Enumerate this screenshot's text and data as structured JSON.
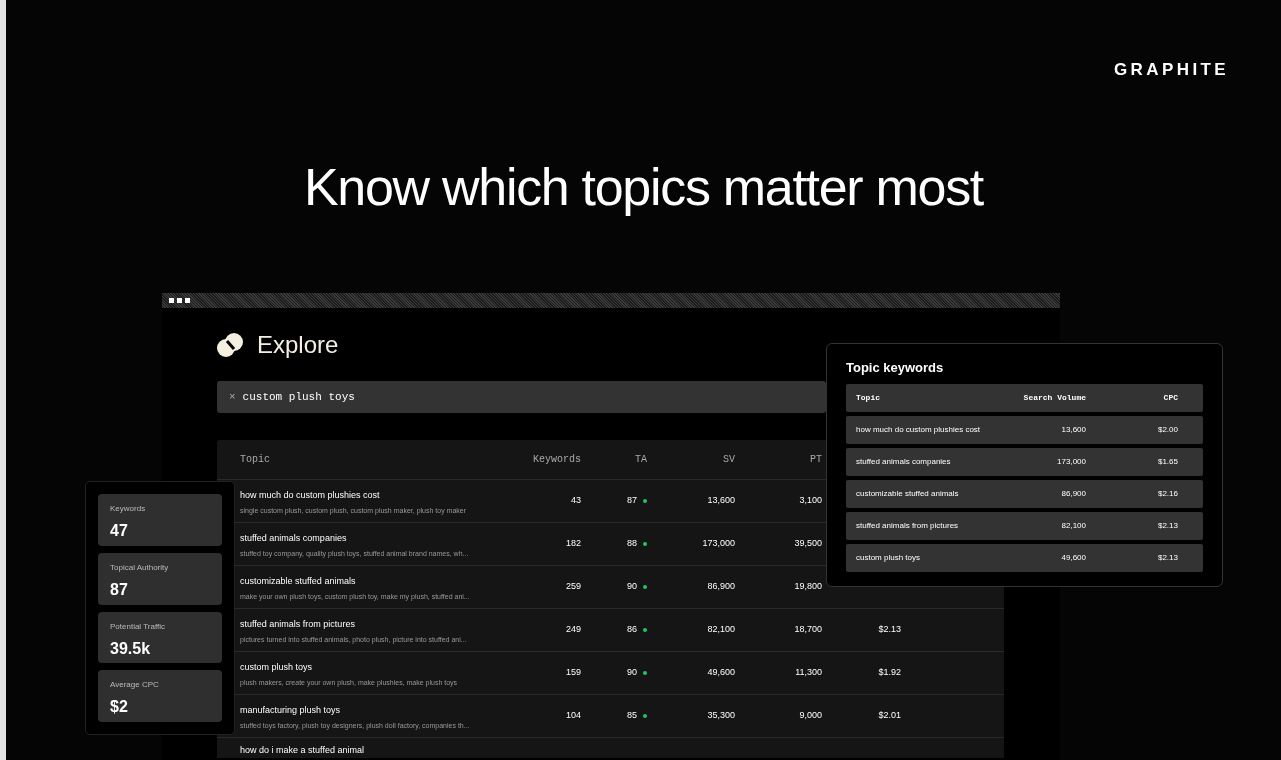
{
  "brand": "GRAPHITE",
  "headline": "Know which topics matter most",
  "app": {
    "title": "Explore",
    "search": {
      "clear": "×",
      "value": "custom plush toys"
    },
    "table": {
      "columns": [
        "Topic",
        "Keywords",
        "TA",
        "SV",
        "PT"
      ],
      "rows": [
        {
          "topic": "how much do custom plushies cost",
          "keywords_list": "single custom plush, custom plush, custom plush maker, plush toy maker",
          "keywords": "43",
          "ta": "87",
          "color": "#22c55e",
          "sv": "13,600",
          "pt": "3,100"
        },
        {
          "topic": "stuffed animals companies",
          "keywords_list": "stuffed toy company, quality plush toys, stuffed animal brand names, wh...",
          "keywords": "182",
          "ta": "88",
          "color": "#22c55e",
          "sv": "173,000",
          "pt": "39,500"
        },
        {
          "topic": "customizable stuffed animals",
          "keywords_list": "make your own plush toys, custom plush toy, make my plush, stuffed ani...",
          "keywords": "259",
          "ta": "90",
          "color": "#22c55e",
          "sv": "86,900",
          "pt": "19,800"
        },
        {
          "topic": "stuffed animals from pictures",
          "keywords_list": "pictures turned into stuffed animals, photo plush, picture into stuffed ani...",
          "keywords": "249",
          "ta": "86",
          "color": "#22c55e",
          "sv": "82,100",
          "pt": "18,700",
          "cpc": "$2.13"
        },
        {
          "topic": "custom plush toys",
          "keywords_list": "plush makers, create your own plush, make plushies, make plush toys",
          "keywords": "159",
          "ta": "90",
          "color": "#22c55e",
          "sv": "49,600",
          "pt": "11,300",
          "cpc": "$1.92"
        },
        {
          "topic": "manufacturing plush toys",
          "keywords_list": "stuffed toys factory, plush toy designers, plush doll factory, companies th...",
          "keywords": "104",
          "ta": "85",
          "color": "#22c55e",
          "sv": "35,300",
          "pt": "9,000",
          "cpc": "$2.01"
        },
        {
          "topic": "how do i make a stuffed animal"
        }
      ]
    }
  },
  "stats": [
    {
      "label": "Keywords",
      "value": "47"
    },
    {
      "label": "Topical Authority",
      "value": "87"
    },
    {
      "label": "Potential Traffic",
      "value": "39.5k"
    },
    {
      "label": "Average CPC",
      "value": "$2"
    }
  ],
  "topic_keywords": {
    "title": "Topic keywords",
    "columns": [
      "Topic",
      "Search Volume",
      "CPC"
    ],
    "rows": [
      {
        "topic": "how much do custom plushies cost",
        "search_volume": "13,600",
        "cpc": "$2.00"
      },
      {
        "topic": "stuffed animals companies",
        "search_volume": "173,000",
        "cpc": "$1.65"
      },
      {
        "topic": "customizable stuffed animals",
        "search_volume": "86,900",
        "cpc": "$2.16"
      },
      {
        "topic": "stuffed animals from pictures",
        "search_volume": "82,100",
        "cpc": "$2.13"
      },
      {
        "topic": "custom plush toys",
        "search_volume": "49,600",
        "cpc": "$2.13"
      }
    ]
  }
}
